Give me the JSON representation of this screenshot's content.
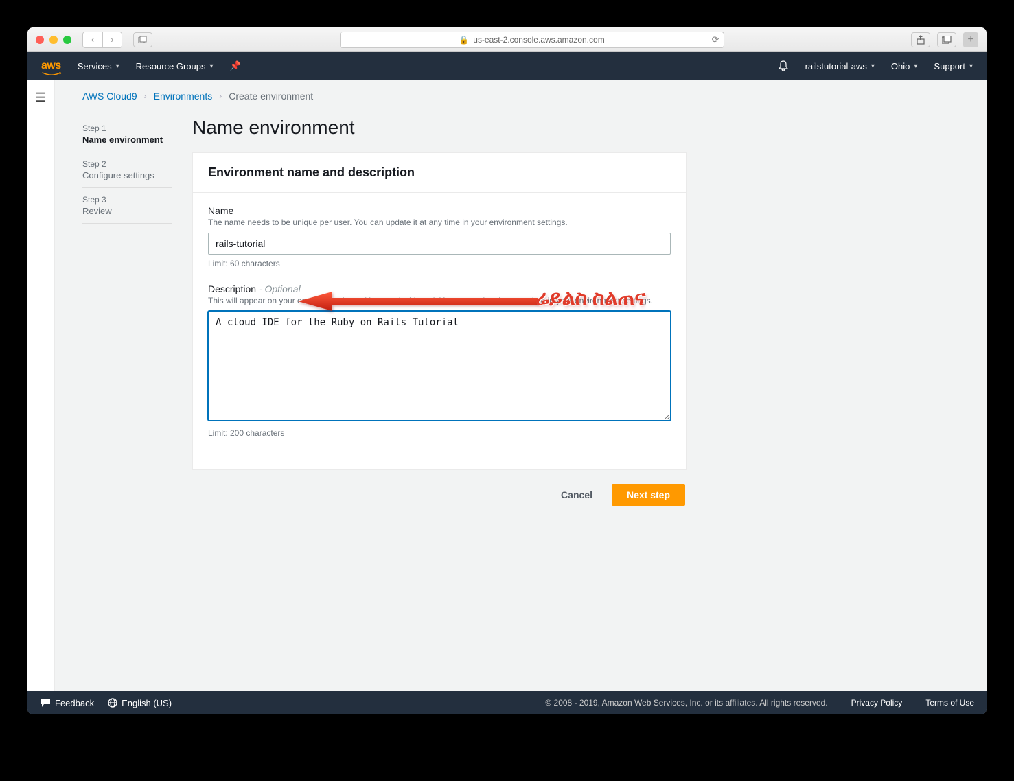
{
  "browser": {
    "urlHost": "us-east-2.console.aws.amazon.com"
  },
  "header": {
    "logo": "aws",
    "services": "Services",
    "resourceGroups": "Resource Groups",
    "account": "railstutorial-aws",
    "region": "Ohio",
    "support": "Support"
  },
  "breadcrumb": {
    "root": "AWS Cloud9",
    "env": "Environments",
    "current": "Create environment"
  },
  "steps": [
    {
      "label": "Step 1",
      "name": "Name environment"
    },
    {
      "label": "Step 2",
      "name": "Configure settings"
    },
    {
      "label": "Step 3",
      "name": "Review"
    }
  ],
  "page": {
    "title": "Name environment",
    "cardTitle": "Environment name and description",
    "nameLabel": "Name",
    "nameHint": "The name needs to be unique per user. You can update it at any time in your environment settings.",
    "nameValue": "rails-tutorial",
    "nameLimit": "Limit: 60 characters",
    "descLabel": "Description",
    "descOptional": "- Optional",
    "descHint": "This will appear on your environment's card in your dashboard. You can update it at any time in your environment settings.",
    "descValue": "A cloud IDE for the Ruby on Rails Tutorial",
    "descLimit": "Limit: 200 characters"
  },
  "actions": {
    "cancel": "Cancel",
    "next": "Next step"
  },
  "annotation": {
    "label": "ሬይልስ ስልጠና"
  },
  "footer": {
    "feedback": "Feedback",
    "language": "English (US)",
    "legal": "© 2008 - 2019, Amazon Web Services, Inc. or its affiliates. All rights reserved.",
    "privacy": "Privacy Policy",
    "terms": "Terms of Use"
  }
}
